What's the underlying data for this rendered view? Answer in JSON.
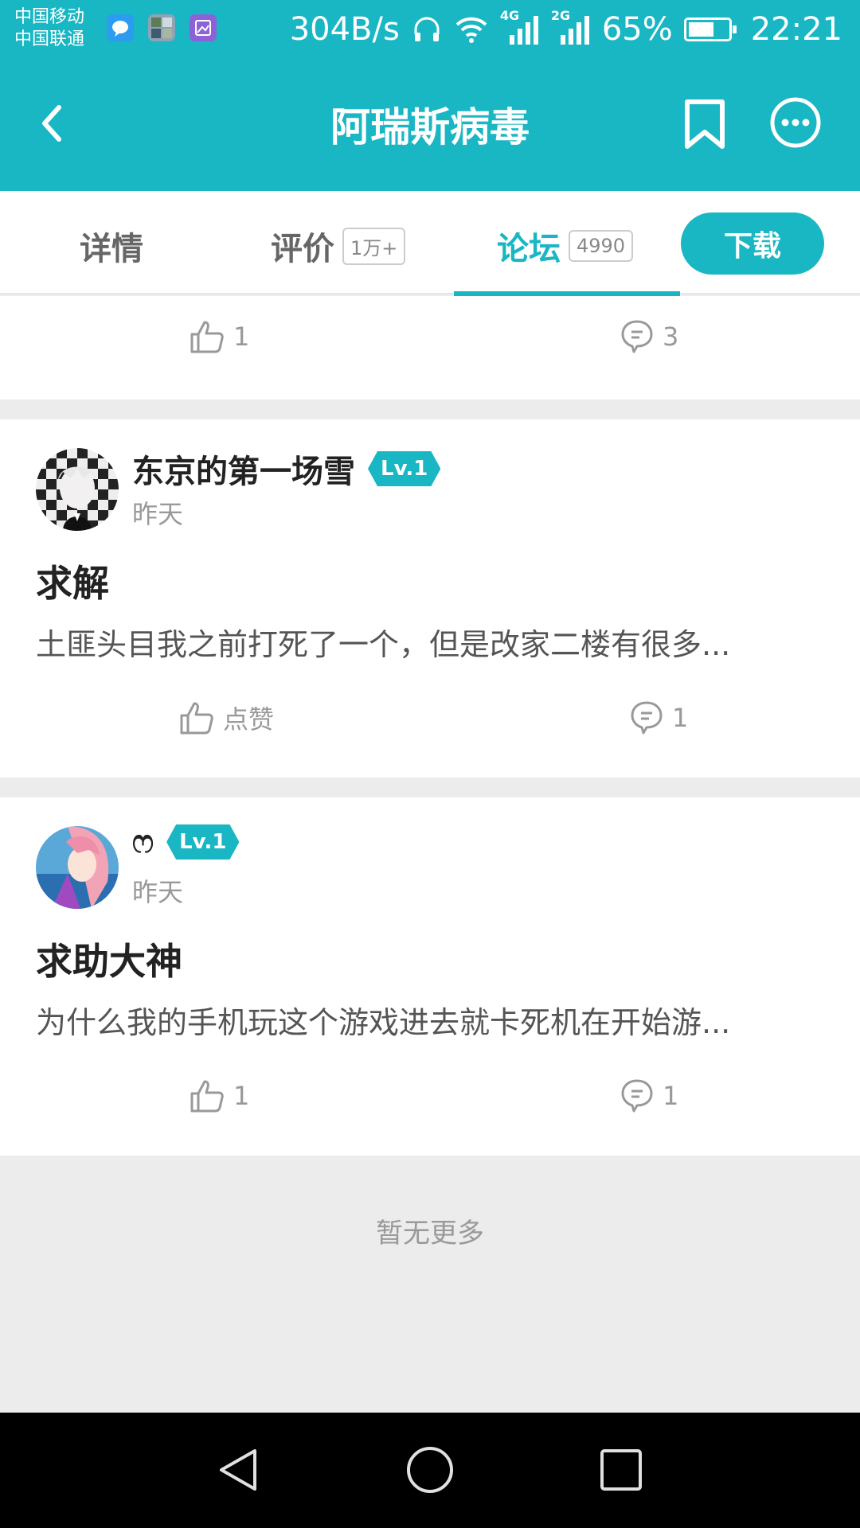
{
  "status_bar": {
    "carrier_1": "中国移动",
    "carrier_2": "中国联通",
    "net_speed": "304B/s",
    "net_4g": "4G",
    "net_2g": "2G",
    "battery": "65%",
    "battery_level": 0.65,
    "time": "22:21"
  },
  "header": {
    "title": "阿瑞斯病毒"
  },
  "tabs": [
    {
      "label": "详情",
      "count": ""
    },
    {
      "label": "评价",
      "count": "1万+"
    },
    {
      "label": "论坛",
      "count": "4990"
    }
  ],
  "download_label": "下载",
  "partial_post": {
    "likes": "1",
    "comments": "3"
  },
  "posts": [
    {
      "username": "东京的第一场雪",
      "level": "Lv.1",
      "time": "昨天",
      "title": "求解",
      "excerpt": "土匪头目我之前打死了一个，但是改家二楼有很多...",
      "likes": "点赞",
      "comments": "1"
    },
    {
      "username": "ෆ",
      "level": "Lv.1",
      "time": "昨天",
      "title": "求助大神",
      "excerpt": "为什么我的手机玩这个游戏进去就卡死机在开始游...",
      "likes": "1",
      "comments": "1"
    }
  ],
  "footer_text": "暂无更多",
  "colors": {
    "accent": "#19b6c4",
    "background": "#ececec"
  }
}
